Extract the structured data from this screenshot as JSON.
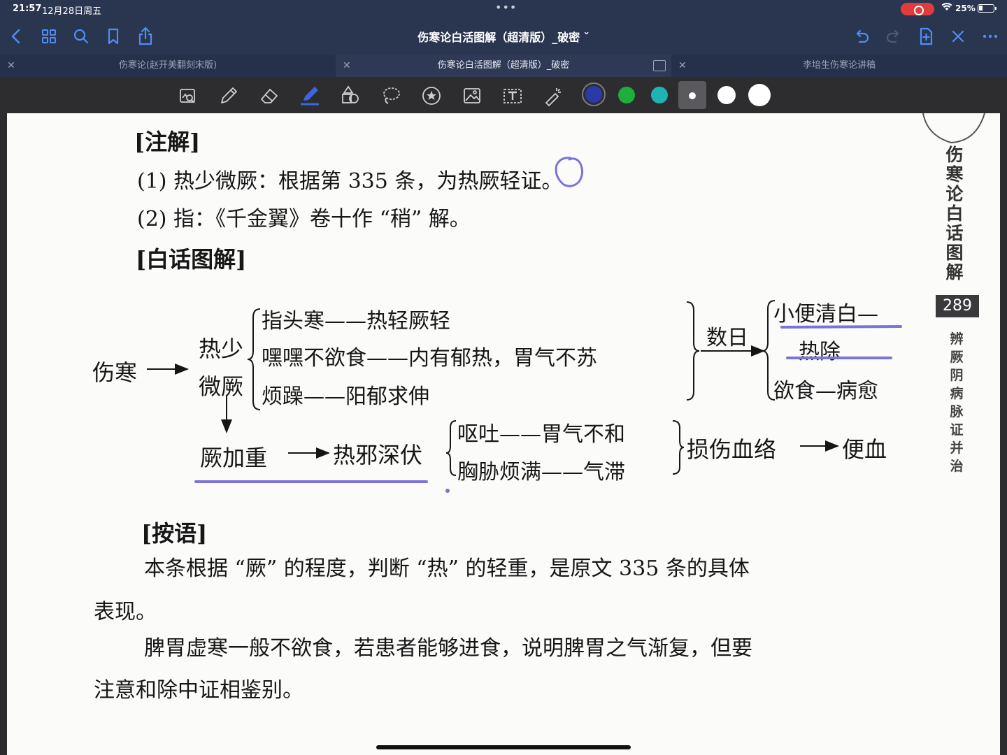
{
  "status_bar": {
    "time": "21:57",
    "date": "12月28日周五",
    "battery": "25%"
  },
  "nav": {
    "title": "伤寒论白活图解（超清版）_破密 ˇ",
    "left_icons": [
      "back-icon",
      "grid-icon",
      "search-icon",
      "bookmark-icon",
      "share-icon"
    ],
    "right_icons": [
      "undo-icon",
      "redo-icon",
      "add-page-icon",
      "close-icon",
      "more-icon"
    ],
    "accent_color": "#4d8ef7"
  },
  "tabs": [
    {
      "label": "伤寒论(赵开美翻刻宋版)"
    },
    {
      "label": "伤寒论白活图解（超清版）_破密"
    },
    {
      "label": "李培生伤寒论讲稿"
    }
  ],
  "toolbar": {
    "tools": [
      "lasso-zoom-icon",
      "pen-icon",
      "eraser-icon",
      "highlighter-icon",
      "shapes-icon",
      "lasso-icon",
      "sticker-icon",
      "image-icon",
      "text-box-icon",
      "laser-pointer-icon"
    ],
    "colors": [
      "#2a3aa8",
      "#1fae3c",
      "#1fb3b3",
      "#ffffff",
      "#ffffff",
      "#ffffff"
    ],
    "annotation_color": "#7b74d9"
  },
  "page": {
    "h_zhujie": "[注解]",
    "note1": "(1) 热少微厥：根据第 335 条，为热厥轻证。",
    "note2": "(2) 指：《千金翼》卷十作 “稍” 解。",
    "h_baihua": "[白话图解]",
    "diagram": {
      "shanghan": "伤寒",
      "reshao": "热少",
      "weijue": "微厥",
      "row1": "指头寒——热轻厥轻",
      "row2": "嘿嘿不欲食——内有郁热，胃气不苏",
      "row3": "烦躁——阳郁求伸",
      "shuri": "数日",
      "out1": "小便清白—",
      "out1b": "热除",
      "out2": "欲食—病愈",
      "jue_jiazhong": "厥加重",
      "rexie": "热邪深伏",
      "sub1": "呕吐——胃气不和",
      "sub2": "胸胁烦满——气滞",
      "sunshang": "损伤血络",
      "bianxue": "便血"
    },
    "h_anyu": "[按语]",
    "p1_line1": "本条根据 “厥” 的程度，判断 “热” 的轻重，是原文 335 条的具体",
    "p1_line2": "表现。",
    "p2_line1": "脾胃虚寒一般不欲食，若患者能够进食，说明脾胃之气渐复，但要",
    "p2_line2": "注意和除中证相鉴别。",
    "sidebar_title": "伤寒论白话图解",
    "page_number": "289",
    "sidebar_sub": "辨厥阴病脉证并治"
  }
}
